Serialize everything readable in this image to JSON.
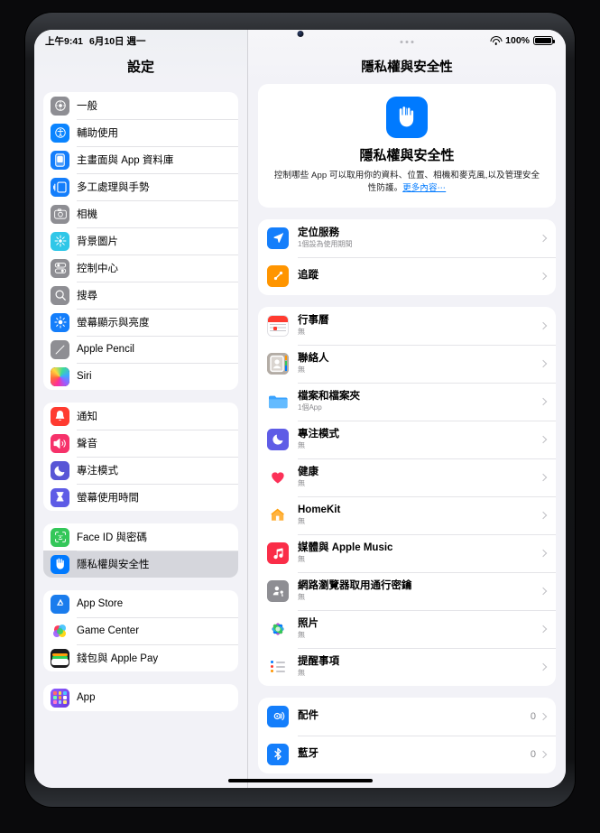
{
  "status_bar": {
    "time": "上午9:41",
    "date": "6月10日 週一",
    "battery_percent": "100%",
    "wifi_icon": "wifi-icon",
    "battery_icon": "battery-full-icon"
  },
  "sidebar": {
    "title": "設定",
    "groups": [
      {
        "items": [
          {
            "label": "一般",
            "icon": "gear-icon",
            "color": "#8e8e93"
          },
          {
            "label": "輔助使用",
            "icon": "accessibility-icon",
            "color": "#0a84ff"
          },
          {
            "label": "主畫面與 App 資料庫",
            "icon": "home-screen-icon",
            "color": "#147efb"
          },
          {
            "label": "多工處理與手勢",
            "icon": "multitasking-icon",
            "color": "#147efb"
          },
          {
            "label": "相機",
            "icon": "camera-icon",
            "color": "#8e8e93"
          },
          {
            "label": "背景圖片",
            "icon": "wallpaper-icon",
            "color": "#30c7e8"
          },
          {
            "label": "控制中心",
            "icon": "control-center-icon",
            "color": "#8e8e93"
          },
          {
            "label": "搜尋",
            "icon": "search-icon",
            "color": "#8e8e93"
          },
          {
            "label": "螢幕顯示與亮度",
            "icon": "brightness-icon",
            "color": "#147efb"
          },
          {
            "label": "Apple Pencil",
            "icon": "pencil-icon",
            "color": "#8e8e93"
          },
          {
            "label": "Siri",
            "icon": "siri-icon",
            "color": "#2b2b35"
          }
        ]
      },
      {
        "items": [
          {
            "label": "通知",
            "icon": "bell-icon",
            "color": "#ff3b30"
          },
          {
            "label": "聲音",
            "icon": "speaker-icon",
            "color": "#f6326a"
          },
          {
            "label": "專注模式",
            "icon": "moon-icon",
            "color": "#5856d6"
          },
          {
            "label": "螢幕使用時間",
            "icon": "hourglass-icon",
            "color": "#5e5ce6"
          }
        ]
      },
      {
        "items": [
          {
            "label": "Face ID 與密碼",
            "icon": "face-id-icon",
            "color": "#34c759"
          },
          {
            "label": "隱私權與安全性",
            "icon": "privacy-hand-icon",
            "color": "#007aff",
            "selected": true
          }
        ]
      },
      {
        "items": [
          {
            "label": "App Store",
            "icon": "app-store-icon",
            "color": "#1a7ced"
          },
          {
            "label": "Game Center",
            "icon": "game-center-icon",
            "color": "#ffffff"
          },
          {
            "label": "錢包與 Apple Pay",
            "icon": "wallet-icon",
            "color": "#1c1c1e"
          }
        ]
      },
      {
        "items": [
          {
            "label": "App",
            "icon": "apps-grid-icon",
            "color": "#7d4ce0"
          }
        ]
      }
    ]
  },
  "detail": {
    "title": "隱私權與安全性",
    "multitask_icon": "multitask-handle-icon",
    "hero": {
      "icon": "privacy-hand-icon",
      "icon_color": "#007aff",
      "title": "隱私權與安全性",
      "description": "控制哪些 App 可以取用你的資料、位置、相機和麥克風,以及管理安全性防護。",
      "link_text": "更多內容⋯"
    },
    "groups": [
      {
        "rows": [
          {
            "label": "定位服務",
            "sublabel": "1個設為使用期間",
            "icon": "location-arrow-icon",
            "color": "#147efb",
            "chevron": true
          },
          {
            "label": "追蹤",
            "sublabel": "",
            "icon": "tracking-icon",
            "color": "#ff9500",
            "chevron": true
          }
        ]
      },
      {
        "rows": [
          {
            "label": "行事曆",
            "sublabel": "無",
            "icon": "calendar-icon",
            "color": "#ffffff",
            "chevron": true
          },
          {
            "label": "聯絡人",
            "sublabel": "無",
            "icon": "contacts-icon",
            "color": "#b0a9a2",
            "chevron": true
          },
          {
            "label": "檔案和檔案夾",
            "sublabel": "1個App",
            "icon": "folder-icon",
            "color": "#ffffff",
            "chevron": true
          },
          {
            "label": "專注模式",
            "sublabel": "無",
            "icon": "moon-icon",
            "color": "#5e5ce6",
            "chevron": true
          },
          {
            "label": "健康",
            "sublabel": "無",
            "icon": "heart-icon",
            "color": "#ffffff",
            "chevron": true
          },
          {
            "label": "HomeKit",
            "sublabel": "無",
            "icon": "home-icon",
            "color": "#ffffff",
            "chevron": true
          },
          {
            "label": "媒體與 Apple Music",
            "sublabel": "無",
            "icon": "music-note-icon",
            "color": "#fa2d48",
            "chevron": true
          },
          {
            "label": "網路瀏覽器取用通行密鑰",
            "sublabel": "無",
            "icon": "passkey-person-icon",
            "color": "#8e8e93",
            "chevron": true
          },
          {
            "label": "照片",
            "sublabel": "無",
            "icon": "photos-icon",
            "color": "#ffffff",
            "chevron": true
          },
          {
            "label": "提醒事項",
            "sublabel": "無",
            "icon": "reminders-icon",
            "color": "#ffffff",
            "chevron": true
          }
        ]
      },
      {
        "rows": [
          {
            "label": "配件",
            "sublabel": "",
            "value": "0",
            "icon": "accessory-icon",
            "color": "#147efb",
            "chevron": true
          },
          {
            "label": "藍牙",
            "sublabel": "",
            "value": "0",
            "icon": "bluetooth-icon",
            "color": "#147efb",
            "chevron": true
          }
        ]
      }
    ]
  }
}
